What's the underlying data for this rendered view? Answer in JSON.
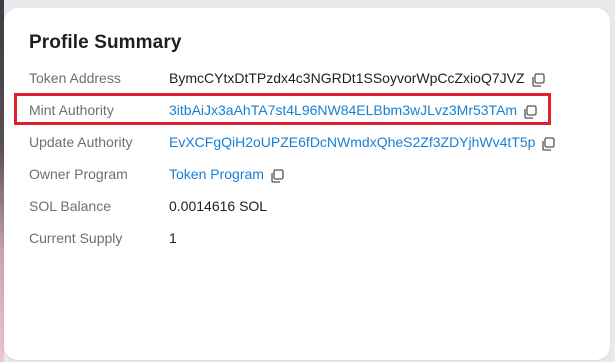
{
  "card": {
    "title": "Profile Summary"
  },
  "rows": [
    {
      "label": "Token Address",
      "value": "BymcCYtxDtTPzdx4c3NGRDt1SSoyvorWpCcZxioQ7JVZ",
      "is_link": false,
      "has_copy": true
    },
    {
      "label": "Mint Authority",
      "value": "3itbAiJx3aAhTA7st4L96NW84ELBbm3wJLvz3Mr53TAm",
      "is_link": true,
      "has_copy": true
    },
    {
      "label": "Update Authority",
      "value": "EvXCFgQiH2oUPZE6fDcNWmdxQheS2Zf3ZDYjhWv4tT5p",
      "is_link": true,
      "has_copy": true
    },
    {
      "label": "Owner Program",
      "value": "Token Program",
      "is_link": true,
      "has_copy": true
    },
    {
      "label": "SOL Balance",
      "value": "0.0014616 SOL",
      "is_link": false,
      "has_copy": false
    },
    {
      "label": "Current Supply",
      "value": "1",
      "is_link": false,
      "has_copy": false
    }
  ],
  "icons": {
    "copy": "copy-icon"
  },
  "colors": {
    "link": "#1a7fd4",
    "highlight": "#e0202e",
    "label": "#6c6f75",
    "text": "#1d1f23"
  }
}
